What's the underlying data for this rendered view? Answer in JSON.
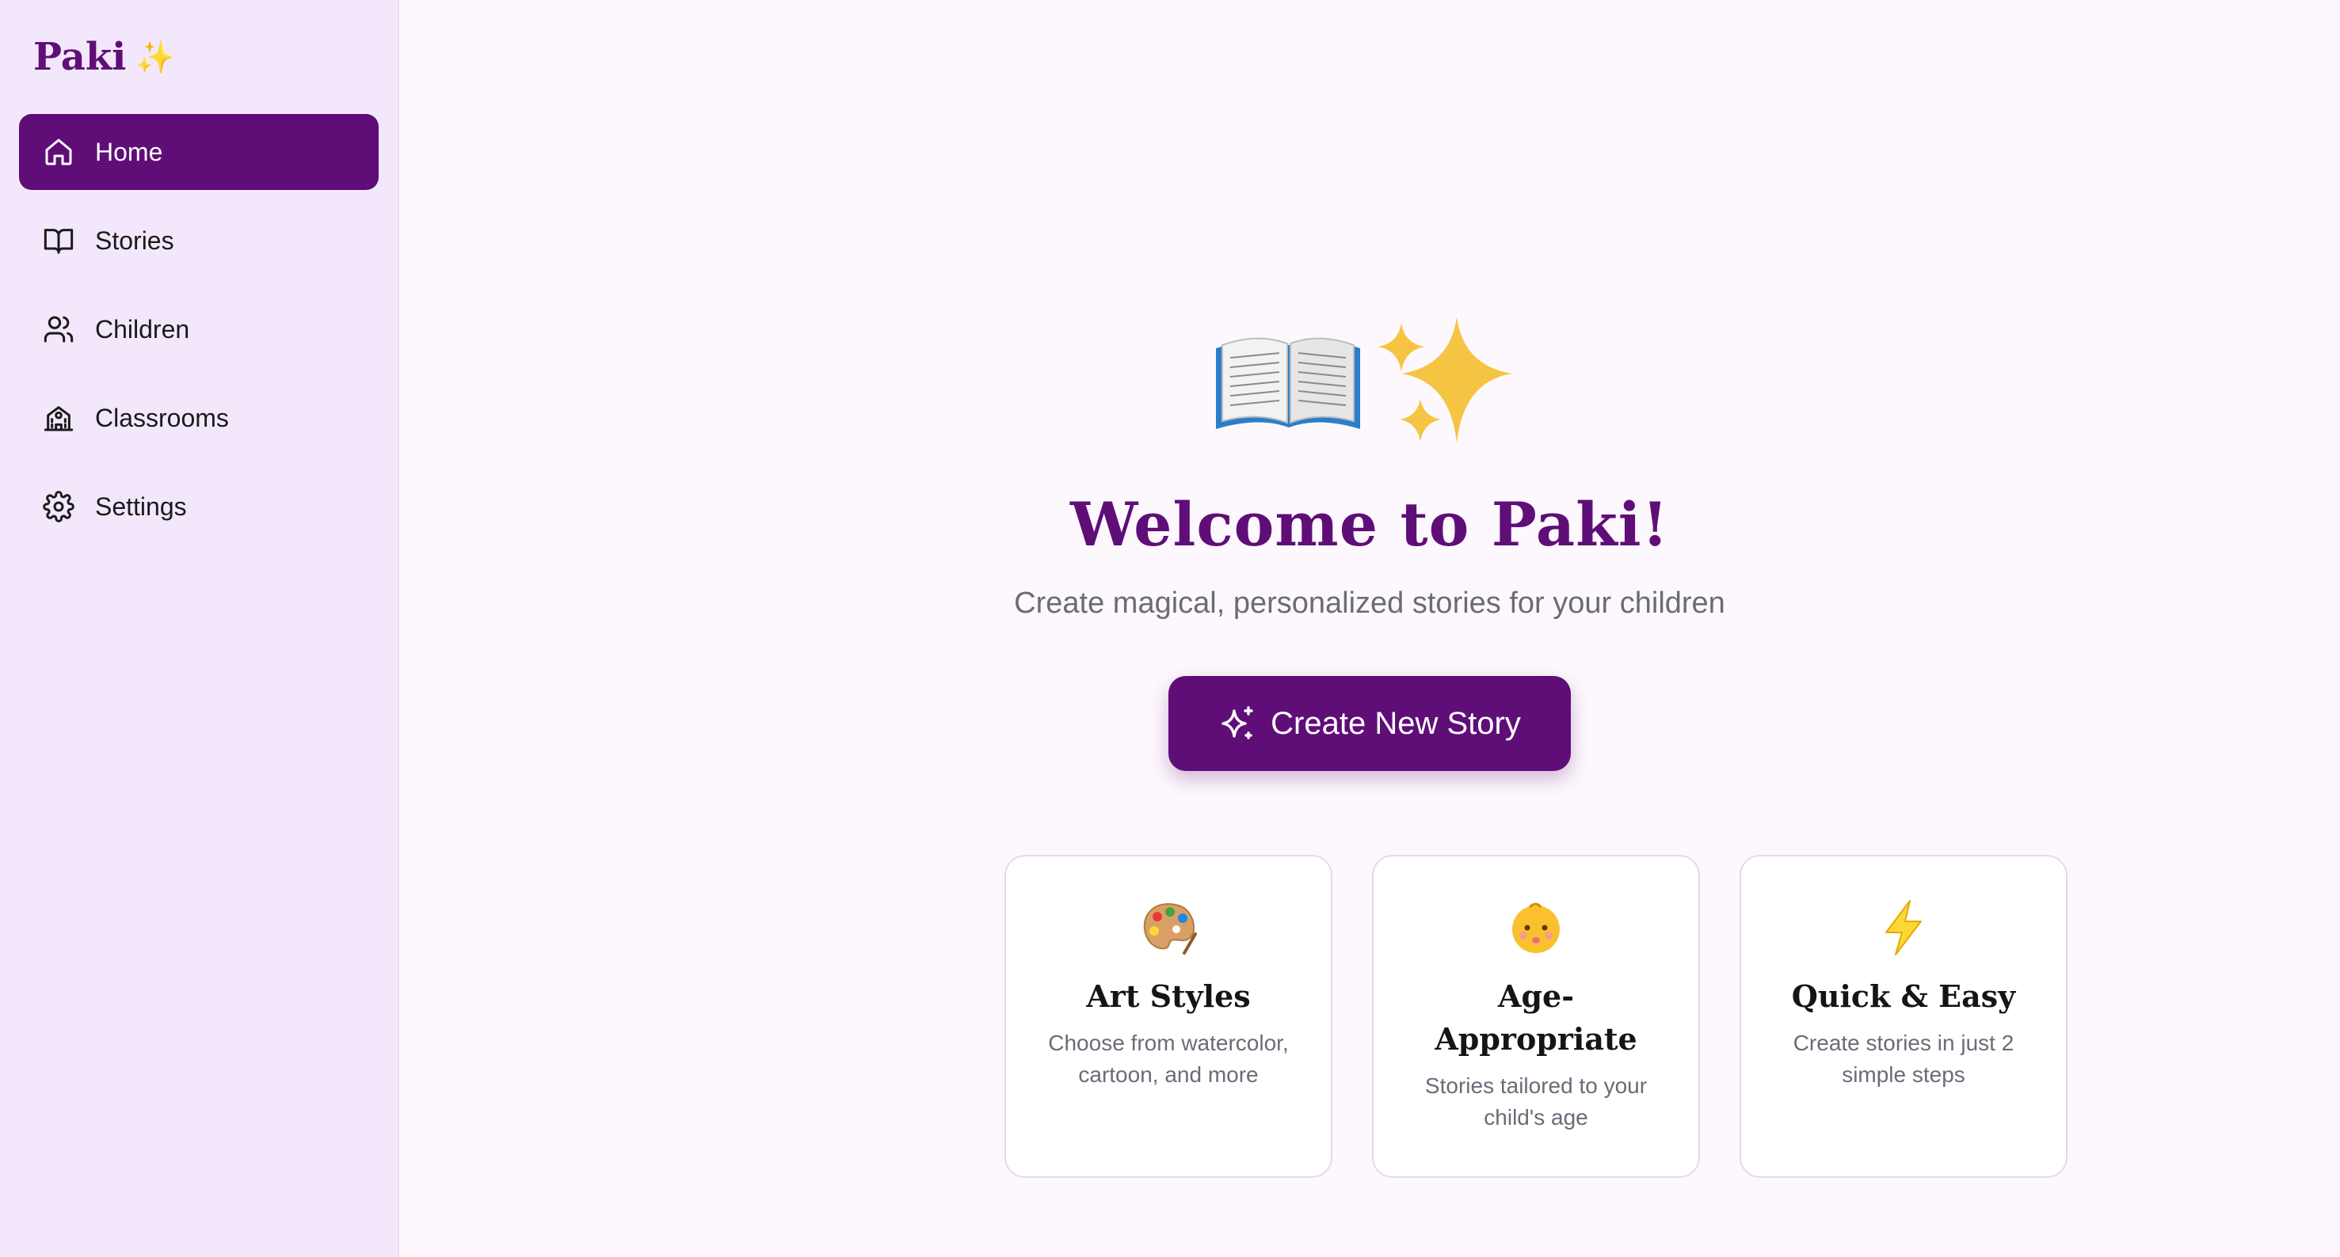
{
  "brand": {
    "name": "Paki",
    "sparkle": "✨"
  },
  "nav": {
    "items": [
      {
        "label": "Home",
        "icon": "home-icon",
        "active": true
      },
      {
        "label": "Stories",
        "icon": "book-icon",
        "active": false
      },
      {
        "label": "Children",
        "icon": "users-icon",
        "active": false
      },
      {
        "label": "Classrooms",
        "icon": "school-icon",
        "active": false
      },
      {
        "label": "Settings",
        "icon": "gear-icon",
        "active": false
      }
    ]
  },
  "hero": {
    "art": "open-book-with-sparkles",
    "title": "Welcome to Paki!",
    "subtitle": "Create magical, personalized stories for your children",
    "cta_label": "Create New Story",
    "cta_icon": "sparkles-icon"
  },
  "features": [
    {
      "icon": "palette-icon",
      "title": "Art Styles",
      "description": "Choose from watercolor, cartoon, and more"
    },
    {
      "icon": "baby-icon",
      "title": "Age-Appropriate",
      "description": "Stories tailored to your child's age"
    },
    {
      "icon": "lightning-icon",
      "title": "Quick & Easy",
      "description": "Create stories in just 2 simple steps"
    }
  ],
  "colors": {
    "brand": "#5f0e78",
    "sidebar_bg": "#f3e8fb",
    "page_bg": "#fdf8fd",
    "muted_text": "#6b6b78"
  }
}
